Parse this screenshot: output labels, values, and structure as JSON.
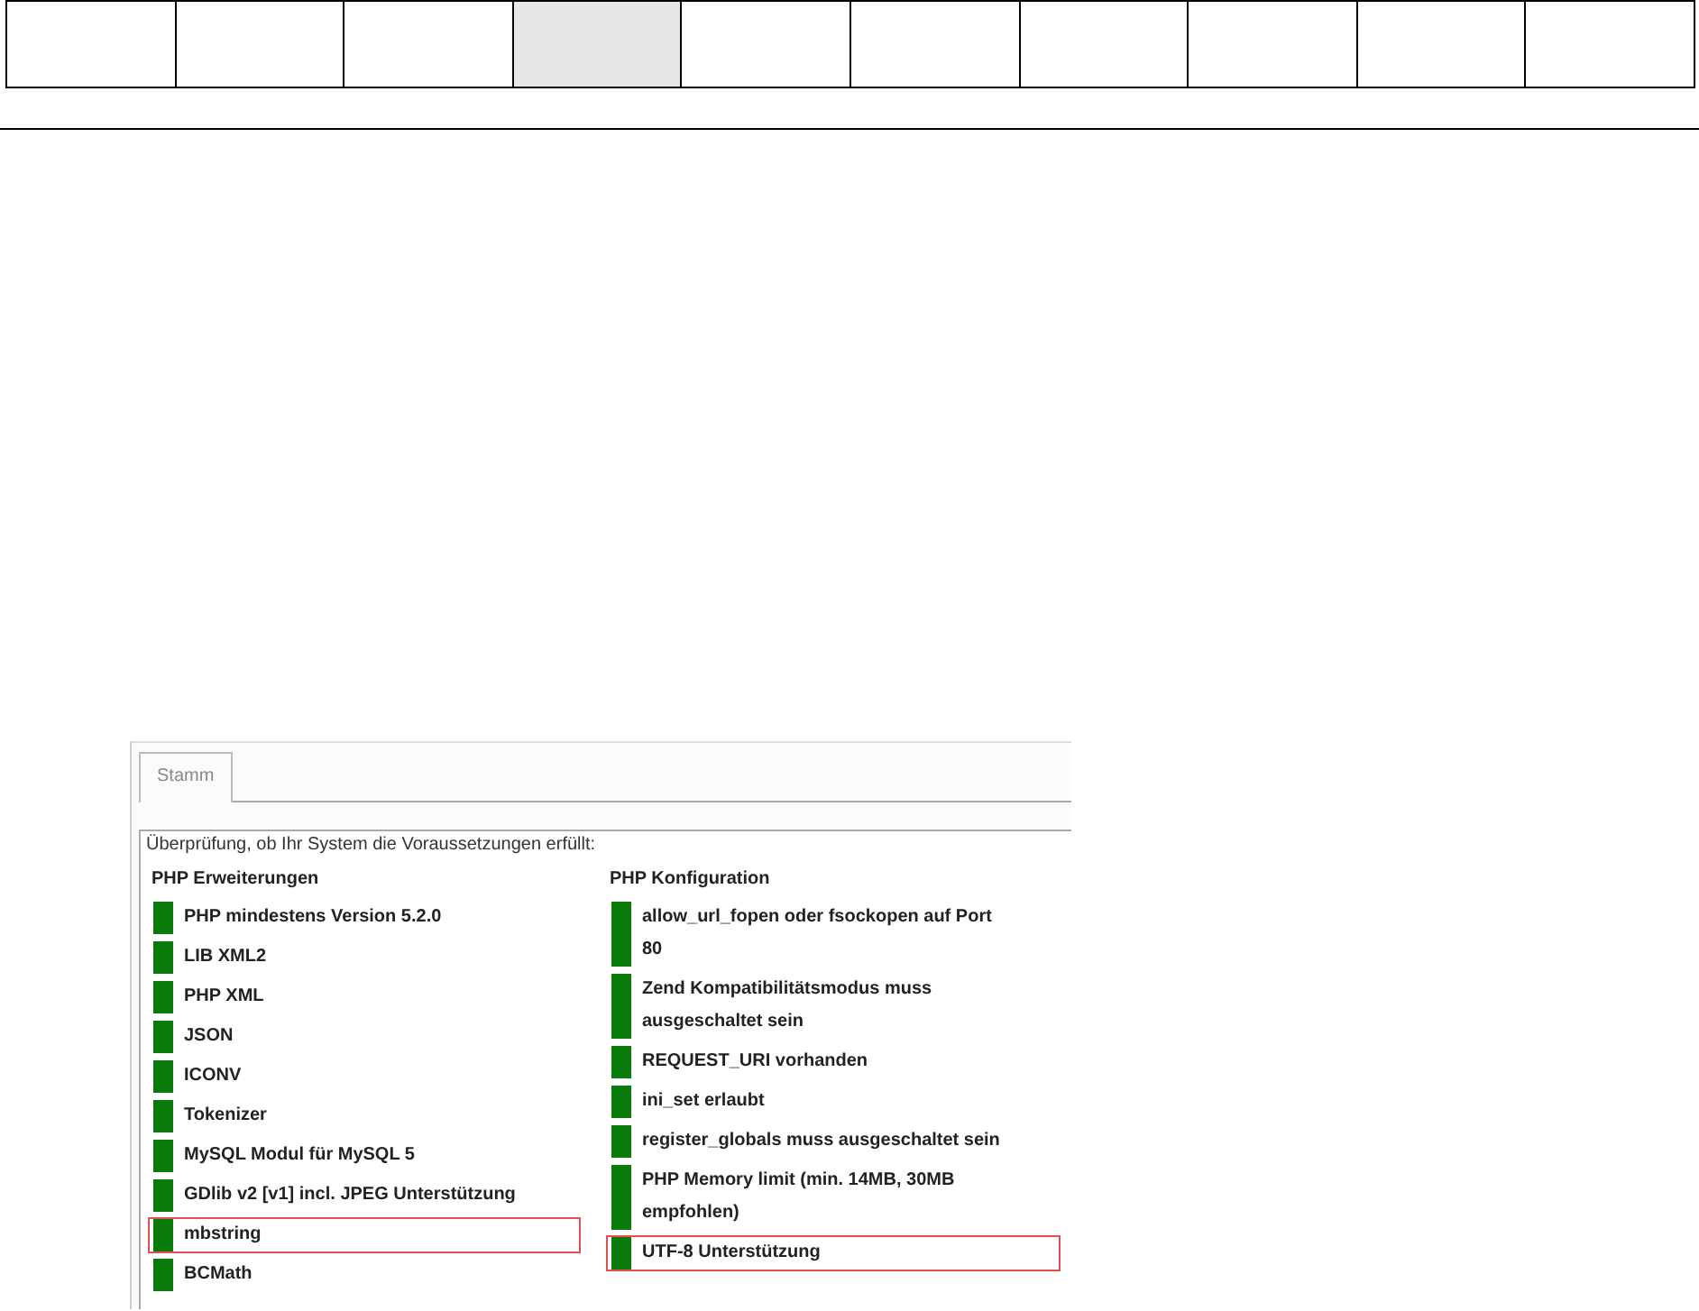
{
  "cells": [
    {
      "selected": false
    },
    {
      "selected": false
    },
    {
      "selected": false
    },
    {
      "selected": true
    },
    {
      "selected": false
    },
    {
      "selected": false
    },
    {
      "selected": false
    },
    {
      "selected": false
    },
    {
      "selected": false
    },
    {
      "selected": false
    }
  ],
  "screenshot": {
    "tab": "Stamm",
    "intro": "Überprüfung, ob Ihr System die Voraussetzungen erfüllt:",
    "columns": [
      {
        "title": "PHP Erweiterungen",
        "items": [
          {
            "label": "PHP mindestens Version 5.2.0",
            "passed": true,
            "highlighted": false
          },
          {
            "label": "LIB XML2",
            "passed": true,
            "highlighted": false
          },
          {
            "label": "PHP XML",
            "passed": true,
            "highlighted": false
          },
          {
            "label": "JSON",
            "passed": true,
            "highlighted": false
          },
          {
            "label": "ICONV",
            "passed": true,
            "highlighted": false
          },
          {
            "label": "Tokenizer",
            "passed": true,
            "highlighted": false
          },
          {
            "label": "MySQL Modul für MySQL 5",
            "passed": true,
            "highlighted": false
          },
          {
            "label": "GDlib v2 [v1] incl. JPEG Unterstützung",
            "passed": true,
            "highlighted": false
          },
          {
            "label": "mbstring",
            "passed": true,
            "highlighted": true
          },
          {
            "label": "BCMath",
            "passed": true,
            "highlighted": false
          }
        ]
      },
      {
        "title": "PHP Konfiguration",
        "items": [
          {
            "label": "allow_url_fopen oder fsockopen auf Port 80",
            "passed": true,
            "highlighted": false
          },
          {
            "label": "Zend Kompatibilitätsmodus muss ausgeschaltet sein",
            "passed": true,
            "highlighted": false
          },
          {
            "label": "REQUEST_URI vorhanden",
            "passed": true,
            "highlighted": false
          },
          {
            "label": "ini_set erlaubt",
            "passed": true,
            "highlighted": false
          },
          {
            "label": "register_globals muss ausgeschaltet sein",
            "passed": true,
            "highlighted": false
          },
          {
            "label": "PHP Memory limit (min. 14MB, 30MB empfohlen)",
            "passed": true,
            "highlighted": false
          },
          {
            "label": "UTF-8 Unterstützung",
            "passed": true,
            "highlighted": true
          }
        ]
      }
    ]
  }
}
